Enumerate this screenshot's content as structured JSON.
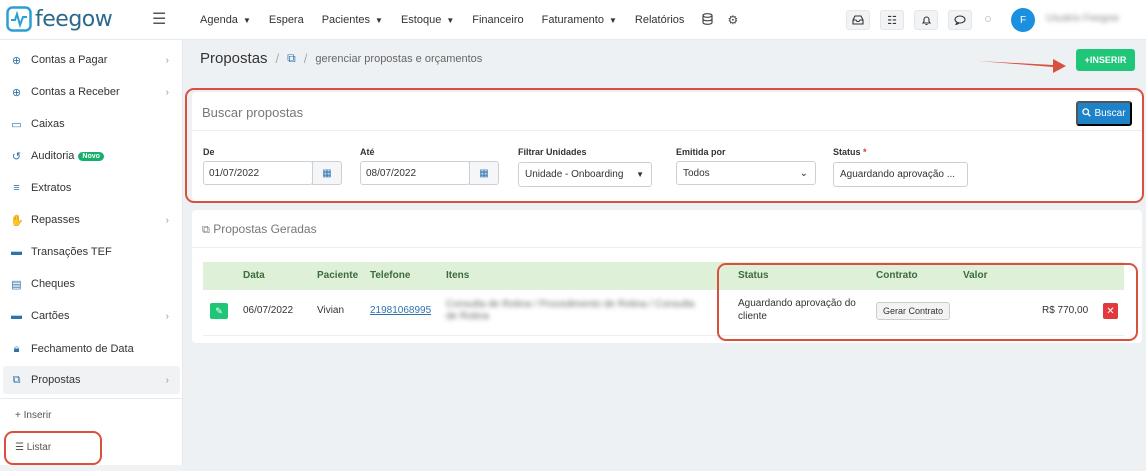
{
  "app": {
    "logo_text": "feegow",
    "username": "Usuário Feegow",
    "avatar_initial": "F"
  },
  "topnav": {
    "items": [
      {
        "label": "Agenda",
        "has_caret": true
      },
      {
        "label": "Espera",
        "has_caret": false
      },
      {
        "label": "Pacientes",
        "has_caret": true
      },
      {
        "label": "Estoque",
        "has_caret": true
      },
      {
        "label": "Financeiro",
        "has_caret": false
      },
      {
        "label": "Faturamento",
        "has_caret": true
      },
      {
        "label": "Relatórios",
        "has_caret": false
      }
    ],
    "icons": [
      "database-icon",
      "settings-icon"
    ],
    "right_icons": [
      "inbox-icon",
      "checklist-icon",
      "bell-icon",
      "chat-icon"
    ]
  },
  "sidebar": {
    "items": [
      {
        "label": "Contas a Pagar",
        "icon": "arrow-up-circle-icon",
        "arrow": true
      },
      {
        "label": "Contas a Receber",
        "icon": "arrow-down-circle-icon",
        "arrow": true
      },
      {
        "label": "Caixas",
        "icon": "inbox-icon",
        "arrow": false
      },
      {
        "label": "Auditoria",
        "icon": "history-icon",
        "arrow": false,
        "badge": "Novo"
      },
      {
        "label": "Extratos",
        "icon": "list-icon",
        "arrow": false
      },
      {
        "label": "Repasses",
        "icon": "hand-money-icon",
        "arrow": true
      },
      {
        "label": "Transações TEF",
        "icon": "card-icon",
        "arrow": false
      },
      {
        "label": "Cheques",
        "icon": "cheque-icon",
        "arrow": false
      },
      {
        "label": "Cartões",
        "icon": "credit-card-icon",
        "arrow": true
      },
      {
        "label": "Fechamento de Data",
        "icon": "lock-icon",
        "arrow": false
      },
      {
        "label": "Propostas",
        "icon": "copy-icon",
        "arrow": true,
        "active": true
      }
    ],
    "sub_items": [
      {
        "label": "Inserir",
        "icon": "+"
      },
      {
        "label": "Listar",
        "icon": "list-ul-icon"
      }
    ]
  },
  "page": {
    "title": "Propostas",
    "subtitle": "gerenciar propostas e orçamentos",
    "insert_button": "INSERIR"
  },
  "search": {
    "title": "Buscar propostas",
    "button": "Buscar",
    "fields": {
      "de": {
        "label": "De",
        "value": "01/07/2022"
      },
      "ate": {
        "label": "Até",
        "value": "08/07/2022"
      },
      "unidades": {
        "label": "Filtrar Unidades",
        "value": "Unidade - Onboarding"
      },
      "emitida": {
        "label": "Emitida por",
        "value": "Todos"
      },
      "status": {
        "label": "Status",
        "required": "*",
        "value": "Aguardando aprovação ..."
      }
    }
  },
  "generated": {
    "title": "Propostas Geradas",
    "columns": [
      "Data",
      "Paciente",
      "Telefone",
      "Itens",
      "Status",
      "Contrato",
      "Valor"
    ],
    "rows": [
      {
        "data": "06/07/2022",
        "paciente": "Vivian",
        "telefone": "21981068995",
        "itens": "Consulta de Rotina / Procedimento de Rotina / Consulta de Rotina",
        "status": "Aguardando aprovação do cliente",
        "contrato": "Gerar Contrato",
        "valor": "R$ 770,00"
      }
    ]
  },
  "colors": {
    "accent": "#2e73ad",
    "success": "#20c678",
    "danger": "#e0393e",
    "highlight": "#d9513e",
    "table_header": "#dff0d8"
  }
}
